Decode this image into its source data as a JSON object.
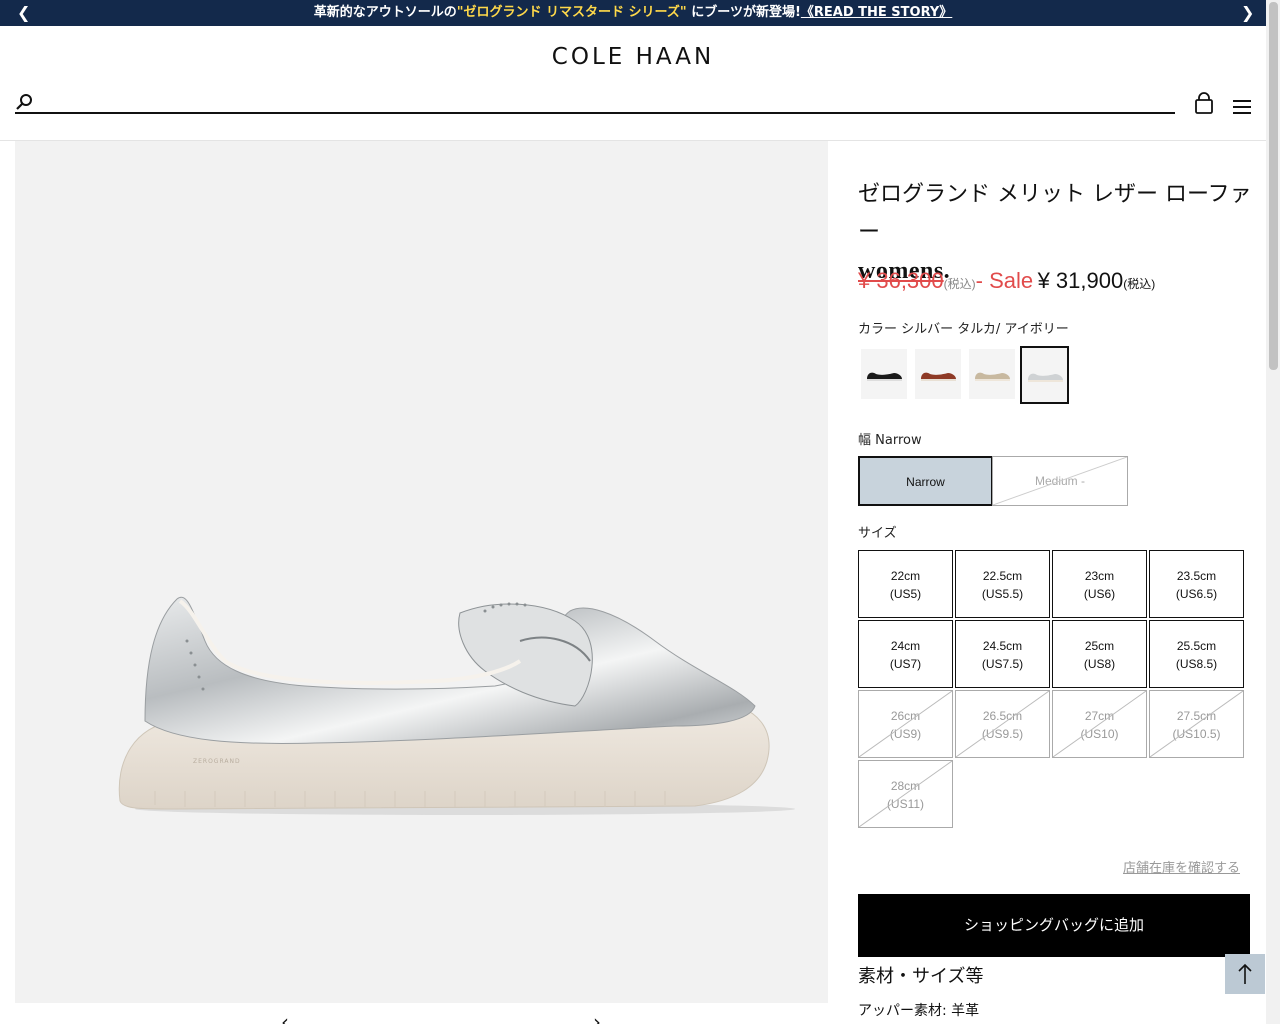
{
  "promo": {
    "text_before": "革新的なアウトソールの",
    "highlight": "\"ゼログランド リマスタード シリーズ\"",
    "text_after": " にブーツが新登場!",
    "story_link": "《READ THE STORY》",
    "prev_icon": "chevron-left-icon",
    "next_icon": "chevron-right-icon"
  },
  "header": {
    "logo": "COLE HAAN",
    "search_placeholder": "",
    "icons": [
      "search-icon",
      "shopping-bag-icon",
      "hamburger-menu-icon"
    ]
  },
  "product": {
    "title": "ゼログランド メリット レザー ローファー",
    "gender": "womens.",
    "price": {
      "original": "¥ 36,300",
      "original_tax": "(税込)",
      "sale_label": "- Sale",
      "current": "¥ 31,900",
      "current_tax": "(税込)"
    },
    "color_label": "カラー",
    "color_value": "シルバー タルカ/ アイボリー",
    "swatches": [
      {
        "name": "black",
        "color": "#1a1a1a"
      },
      {
        "name": "brown",
        "color": "#8e3a26"
      },
      {
        "name": "champagne",
        "color": "#c8b9a0"
      },
      {
        "name": "silver",
        "color": "#cfd2d4",
        "selected": true
      }
    ],
    "width_label": "幅",
    "width_value": "Narrow",
    "widths": [
      {
        "label": "Narrow",
        "selected": true,
        "available": true
      },
      {
        "label": "Medium -",
        "selected": false,
        "available": false
      }
    ],
    "size_label": "サイズ",
    "sizes": [
      {
        "cm": "22cm",
        "us": "(US5)",
        "available": true
      },
      {
        "cm": "22.5cm",
        "us": "(US5.5)",
        "available": true
      },
      {
        "cm": "23cm",
        "us": "(US6)",
        "available": true
      },
      {
        "cm": "23.5cm",
        "us": "(US6.5)",
        "available": true
      },
      {
        "cm": "24cm",
        "us": "(US7)",
        "available": true
      },
      {
        "cm": "24.5cm",
        "us": "(US7.5)",
        "available": true
      },
      {
        "cm": "25cm",
        "us": "(US8)",
        "available": true
      },
      {
        "cm": "25.5cm",
        "us": "(US8.5)",
        "available": true
      },
      {
        "cm": "26cm",
        "us": "(US9)",
        "available": false
      },
      {
        "cm": "26.5cm",
        "us": "(US9.5)",
        "available": false
      },
      {
        "cm": "27cm",
        "us": "(US10)",
        "available": false
      },
      {
        "cm": "27.5cm",
        "us": "(US10.5)",
        "available": false
      },
      {
        "cm": "28cm",
        "us": "(US11)",
        "available": false
      }
    ],
    "store_stock_link": "店舗在庫を確認する",
    "add_to_bag": "ショッピングバッグに追加",
    "details_title": "素材・サイズ等",
    "material_label": "アッパー素材:",
    "material_value": "羊革"
  },
  "gallery": {
    "prev_icon": "chevron-left-icon",
    "next_icon": "chevron-right-icon",
    "sole_text": "ZEROGRAND"
  },
  "back_to_top_icon": "arrow-up-icon"
}
